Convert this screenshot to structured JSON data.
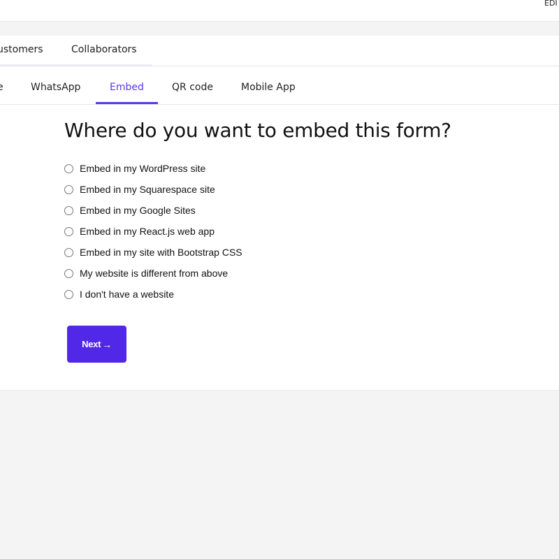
{
  "topbar": {
    "edit_label": "EDI"
  },
  "main_tabs": [
    {
      "label": "ustomers"
    },
    {
      "label": "Collaborators"
    }
  ],
  "share_tabs": [
    {
      "label": "e"
    },
    {
      "label": "WhatsApp"
    },
    {
      "label": "Embed",
      "active": true
    },
    {
      "label": "QR code"
    },
    {
      "label": "Mobile App"
    }
  ],
  "embed": {
    "heading": "Where do you want to embed this form?",
    "options": [
      {
        "label": "Embed in my WordPress site",
        "selected": false
      },
      {
        "label": "Embed in my Squarespace site",
        "selected": false
      },
      {
        "label": "Embed in my Google Sites",
        "selected": false
      },
      {
        "label": "Embed in my React.js web app",
        "selected": false
      },
      {
        "label": "Embed in my site with Bootstrap CSS",
        "selected": false
      },
      {
        "label": "My website is different from above",
        "selected": false
      },
      {
        "label": "I don't have a website",
        "selected": false
      }
    ],
    "next_label": "Next",
    "next_icon": "→"
  },
  "colors": {
    "accent": "#5a36f0",
    "button": "#5128e8",
    "page_bg": "#f4f4f4"
  }
}
